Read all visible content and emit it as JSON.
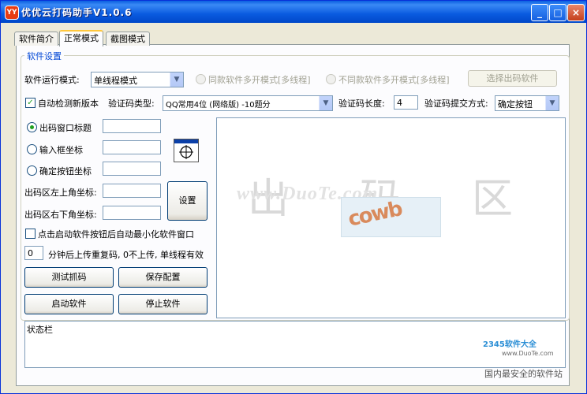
{
  "window": {
    "title": "优优云打码助手V1.0.6",
    "controls": {
      "minimize": "_",
      "maximize": "□",
      "close": "×"
    }
  },
  "tabs": [
    {
      "label": "软件简介",
      "active": false
    },
    {
      "label": "正常模式",
      "active": true
    },
    {
      "label": "截图模式",
      "active": false
    }
  ],
  "settings": {
    "group_title": "软件设置",
    "run_mode_label": "软件运行模式:",
    "run_mode_value": "单线程模式",
    "radio_same": "同款软件多开模式[多线程]",
    "radio_diff": "不同款软件多开模式[多线程]",
    "select_software_button": "选择出码软件",
    "auto_check_label": "自动检测新版本",
    "auto_check_checked": true,
    "captcha_type_label": "验证码类型:",
    "captcha_type_value": "QQ常用4位 (网络版) -10题分",
    "captcha_length_label": "验证码长度:",
    "captcha_length_value": "4",
    "submit_method_label": "验证码提交方式:",
    "submit_method_value": "确定按钮"
  },
  "coords": {
    "window_title_radio": "出码窗口标题",
    "input_box_radio": "输入框坐标",
    "confirm_button_radio": "确定按钮坐标",
    "top_left_label": "出码区左上角坐标:",
    "bottom_right_label": "出码区右下角坐标:",
    "set_button": "设置"
  },
  "options": {
    "minimize_label": "点击启动软件按钮后自动最小化软件窗口",
    "minimize_checked": false,
    "retry_value": "0",
    "retry_label": "分钟后上传重复码, 0不上传, 单线程有效"
  },
  "buttons": {
    "test_capture": "测试抓码",
    "save_config": "保存配置",
    "start": "启动软件",
    "stop": "停止软件"
  },
  "preview": {
    "watermark_chars": [
      "出",
      "码",
      "区"
    ],
    "watermark_url": "www.DuoTe.com",
    "captcha_text": "cowb"
  },
  "status": {
    "label": "状态栏"
  },
  "corner_watermark": {
    "brand": "2345软件大全",
    "url": "www.DuoTe.com",
    "slogan": "国内最安全的软件站"
  }
}
